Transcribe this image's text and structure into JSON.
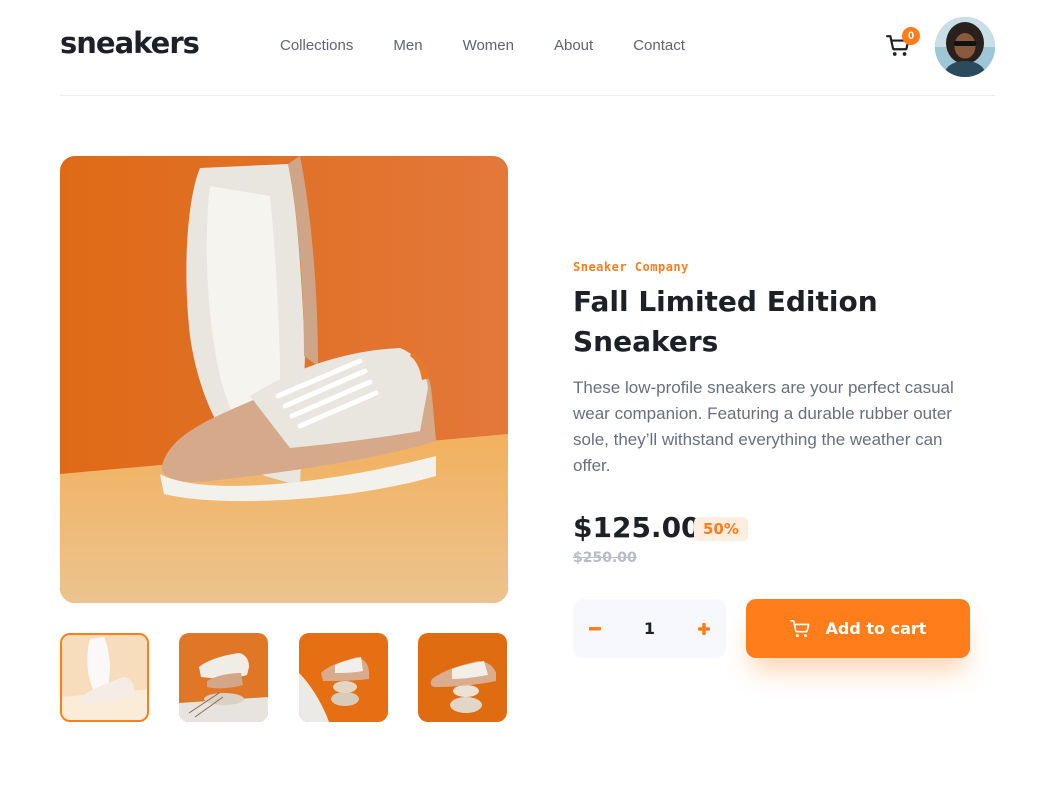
{
  "header": {
    "logo": "sneakers",
    "nav": [
      "Collections",
      "Men",
      "Women",
      "About",
      "Contact"
    ],
    "cart_count": "0",
    "icons": {
      "cart": "cart-icon",
      "avatar": "user-avatar"
    }
  },
  "product": {
    "company": "Sneaker Company",
    "title": "Fall Limited Edition Sneakers",
    "description": "These low-profile sneakers are your perfect casual wear companion. Featuring a durable rubber outer sole, they’ll withstand everything the weather can offer.",
    "price": "$125.00",
    "discount": "50%",
    "original_price": "$250.00",
    "quantity": "1",
    "add_to_cart_label": "Add to cart"
  },
  "gallery": {
    "active_thumbnail": 1,
    "thumbnail_count": 4
  },
  "colors": {
    "accent": "#ff7d1a",
    "accent_pale": "#ffede0",
    "text_dark": "#1d2026",
    "text_gray": "#68707d",
    "text_light": "#b6bcc8",
    "surface": "#f6f8fd"
  }
}
